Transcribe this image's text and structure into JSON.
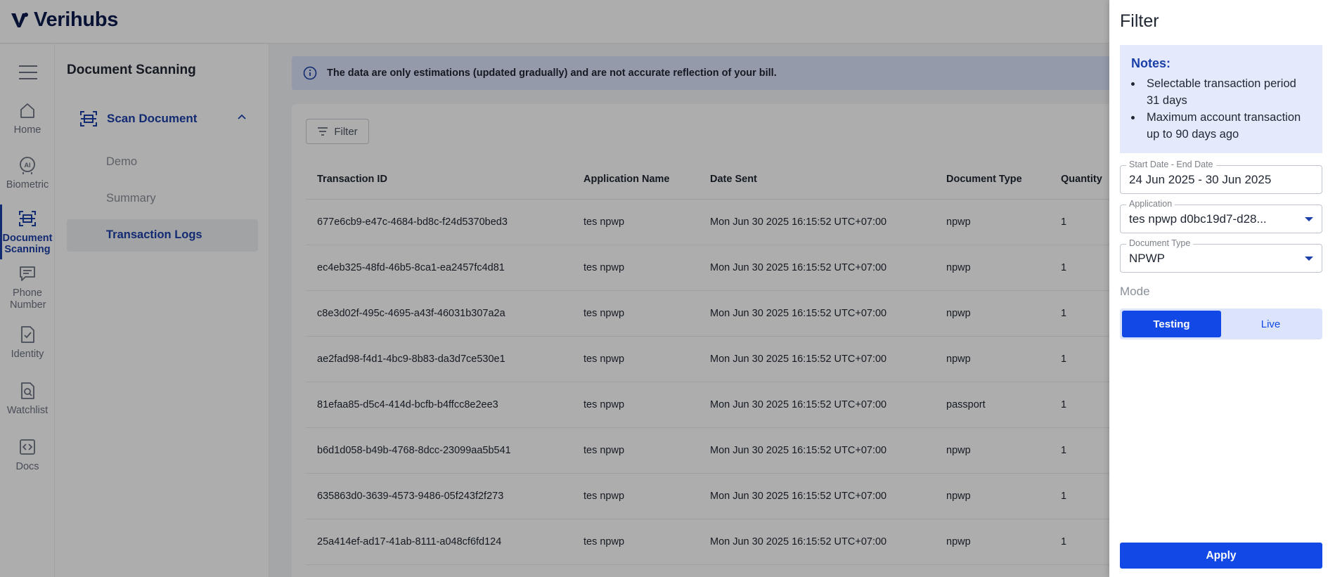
{
  "brand": {
    "name": "Verihubs"
  },
  "rail": {
    "items": [
      {
        "label": "Home",
        "icon": "home-icon"
      },
      {
        "label": "Biometric",
        "icon": "ai-face-icon"
      },
      {
        "label": "Document Scanning",
        "icon": "document-scan-icon",
        "active": true
      },
      {
        "label": "Phone Number",
        "icon": "chat-icon"
      },
      {
        "label": "Identity",
        "icon": "id-check-icon"
      },
      {
        "label": "Watchlist",
        "icon": "search-document-icon"
      },
      {
        "label": "Docs",
        "icon": "code-file-icon"
      }
    ]
  },
  "subnav": {
    "title": "Document Scanning",
    "group": "Scan Document",
    "links": [
      "Demo",
      "Summary",
      "Transaction Logs"
    ],
    "active_link": "Transaction Logs"
  },
  "banner": {
    "text": "The data are only estimations (updated gradually) and are not accurate reflection of your bill."
  },
  "toolbar": {
    "filter_label": "Filter"
  },
  "table": {
    "columns": [
      "Transaction ID",
      "Application Name",
      "Date Sent",
      "Document Type",
      "Quantity"
    ],
    "rows": [
      [
        "677e6cb9-e47c-4684-bd8c-f24d5370bed3",
        "tes npwp",
        "Mon Jun 30 2025 16:15:52 UTC+07:00",
        "npwp",
        "1"
      ],
      [
        "ec4eb325-48fd-46b5-8ca1-ea2457fc4d81",
        "tes npwp",
        "Mon Jun 30 2025 16:15:52 UTC+07:00",
        "npwp",
        "1"
      ],
      [
        "c8e3d02f-495c-4695-a43f-46031b307a2a",
        "tes npwp",
        "Mon Jun 30 2025 16:15:52 UTC+07:00",
        "npwp",
        "1"
      ],
      [
        "ae2fad98-f4d1-4bc9-8b83-da3d7ce530e1",
        "tes npwp",
        "Mon Jun 30 2025 16:15:52 UTC+07:00",
        "npwp",
        "1"
      ],
      [
        "81efaa85-d5c4-414d-bcfb-b4ffcc8e2ee3",
        "tes npwp",
        "Mon Jun 30 2025 16:15:52 UTC+07:00",
        "passport",
        "1"
      ],
      [
        "b6d1d058-b49b-4768-8dcc-23099aa5b541",
        "tes npwp",
        "Mon Jun 30 2025 16:15:52 UTC+07:00",
        "npwp",
        "1"
      ],
      [
        "635863d0-3639-4573-9486-05f243f2f273",
        "tes npwp",
        "Mon Jun 30 2025 16:15:52 UTC+07:00",
        "npwp",
        "1"
      ],
      [
        "25a414ef-ad17-41ab-8111-a048cf6fd124",
        "tes npwp",
        "Mon Jun 30 2025 16:15:52 UTC+07:00",
        "npwp",
        "1"
      ]
    ]
  },
  "drawer": {
    "title": "Filter",
    "notes_title": "Notes:",
    "notes": [
      "Selectable transaction period 31 days",
      "Maximum account transaction up to 90 days ago"
    ],
    "date_label": "Start Date - End Date",
    "date_value": "24 Jun 2025 - 30 Jun 2025",
    "application_label": "Application",
    "application_value": "tes npwp d0bc19d7-d28...",
    "doctype_label": "Document Type",
    "doctype_value": "NPWP",
    "mode_label": "Mode",
    "mode_options": [
      "Testing",
      "Live"
    ],
    "mode_selected": "Testing",
    "apply_label": "Apply"
  },
  "colors": {
    "primary": "#1249e6",
    "brand_navy": "#0d1b4d",
    "banner_bg": "#dbe4fb",
    "notes_bg": "#e4eafb",
    "active_nav": "#1b3fa8"
  }
}
